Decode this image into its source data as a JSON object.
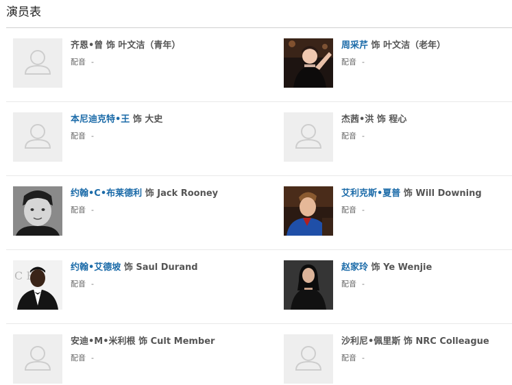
{
  "section": {
    "title": "演员表"
  },
  "cast": [
    {
      "name": "齐恩•曾",
      "linked": false,
      "connector": "饰",
      "role": "叶文洁（青年）",
      "dub_label": "配音",
      "dub_value": "-",
      "photo": "placeholder"
    },
    {
      "name": "周采芹",
      "linked": true,
      "connector": "饰",
      "role": "叶文洁（老年）",
      "dub_label": "配音",
      "dub_value": "-",
      "photo": "woman-dark-stage"
    },
    {
      "name": "本尼迪克特•王",
      "linked": true,
      "connector": "饰",
      "role": "大史",
      "dub_label": "配音",
      "dub_value": "-",
      "photo": "placeholder"
    },
    {
      "name": "杰茜•洪",
      "linked": false,
      "connector": "饰",
      "role": "程心",
      "dub_label": "配音",
      "dub_value": "-",
      "photo": "placeholder"
    },
    {
      "name": "约翰•C•布莱德利",
      "linked": true,
      "connector": "饰",
      "role": "Jack Rooney",
      "dub_label": "配音",
      "dub_value": "-",
      "photo": "man-bw-portrait"
    },
    {
      "name": "艾利克斯•夏普",
      "linked": true,
      "connector": "饰",
      "role": "Will Downing",
      "dub_label": "配音",
      "dub_value": "-",
      "photo": "man-blue-jacket"
    },
    {
      "name": "约翰•艾德坡",
      "linked": true,
      "connector": "饰",
      "role": "Saul Durand",
      "dub_label": "配音",
      "dub_value": "-",
      "photo": "man-tuxedo"
    },
    {
      "name": "赵家玲",
      "linked": true,
      "connector": "饰",
      "role": "Ye Wenjie",
      "dub_label": "配音",
      "dub_value": "-",
      "photo": "woman-black-outfit"
    },
    {
      "name": "安迪•M•米利根",
      "linked": false,
      "connector": "饰",
      "role": "Cult Member",
      "dub_label": "配音",
      "dub_value": "-",
      "photo": "placeholder"
    },
    {
      "name": "沙利尼•佩里斯",
      "linked": false,
      "connector": "饰",
      "role": "NRC Colleague",
      "dub_label": "配音",
      "dub_value": "-",
      "photo": "placeholder"
    }
  ],
  "photo_backdrop_text": "C R"
}
